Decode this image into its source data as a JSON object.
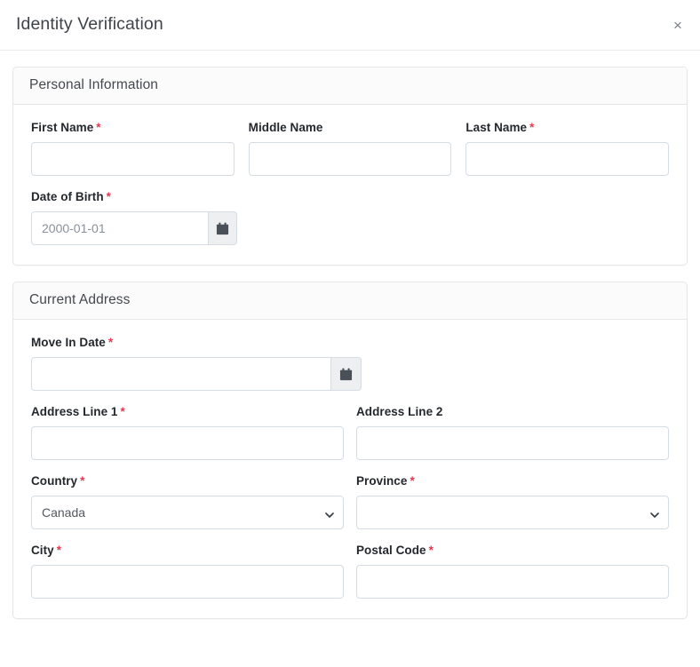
{
  "modal": {
    "title": "Identity Verification",
    "close_label": "×",
    "close_icon": "close-icon"
  },
  "sections": [
    {
      "id": "personal-information",
      "title": "Personal Information",
      "fields": {
        "first_name": {
          "label": "First Name",
          "required_marker": "*",
          "value": "",
          "placeholder": ""
        },
        "middle_name": {
          "label": "Middle Name",
          "required_marker": "",
          "value": "",
          "placeholder": ""
        },
        "last_name": {
          "label": "Last Name",
          "required_marker": "*",
          "value": "",
          "placeholder": ""
        },
        "date_of_birth": {
          "label": "Date of Birth",
          "required_marker": "*",
          "value": "",
          "placeholder": "2000-01-01",
          "button_icon": "calendar-icon"
        }
      }
    },
    {
      "id": "current-address",
      "title": "Current Address",
      "fields": {
        "move_in_date": {
          "label": "Move In Date",
          "required_marker": "*",
          "value": "",
          "placeholder": "",
          "button_icon": "calendar-icon"
        },
        "address_line_1": {
          "label": "Address Line 1",
          "required_marker": "*",
          "value": "",
          "placeholder": ""
        },
        "address_line_2": {
          "label": "Address Line 2",
          "required_marker": "",
          "value": "",
          "placeholder": ""
        },
        "country": {
          "label": "Country",
          "required_marker": "*",
          "selected": "Canada",
          "options": [
            "Canada"
          ]
        },
        "province": {
          "label": "Province",
          "required_marker": "*",
          "selected": "",
          "options": [
            ""
          ]
        },
        "city": {
          "label": "City",
          "required_marker": "*",
          "value": "",
          "placeholder": ""
        },
        "postal_code": {
          "label": "Postal Code",
          "required_marker": "*",
          "value": "",
          "placeholder": ""
        }
      }
    }
  ],
  "colors": {
    "required_asterisk": "#e5384f",
    "border": "#d6dce3",
    "card_border": "#e4e6e9",
    "header_bg": "#fbfbfc",
    "calendar_icon": "#495057",
    "title_text": "#3f4449"
  }
}
